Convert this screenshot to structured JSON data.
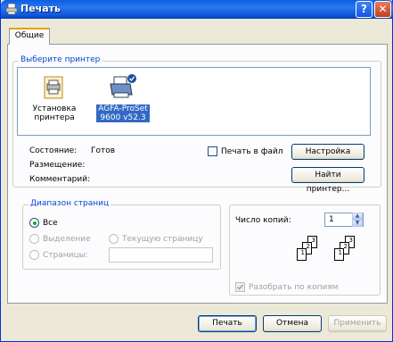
{
  "window": {
    "title": "Печать",
    "help_btn": "?",
    "close_btn": "✕"
  },
  "tabs": [
    {
      "label": "Общие",
      "active": true
    }
  ],
  "printer_group": {
    "title": "Выберите принтер",
    "printers": [
      {
        "line1": "Установка",
        "line2": "принтера",
        "selected": false,
        "icon": "add-printer-icon"
      },
      {
        "line1": "AGFA-ProSet",
        "line2": "9600 v52.3",
        "selected": true,
        "icon": "printer-icon"
      }
    ],
    "status_label": "Состояние:",
    "status_value": "Готов",
    "location_label": "Размещение:",
    "comment_label": "Комментарий:",
    "print_to_file_label": "Печать в файл",
    "print_to_file_checked": false,
    "settings_button": "Настройка",
    "find_printer_button": "Найти принтер..."
  },
  "range_group": {
    "title": "Диапазон страниц",
    "all_label": "Все",
    "selection_label": "Выделение",
    "current_page_label": "Текущую страницу",
    "pages_label": "Страницы:",
    "pages_value": "",
    "selected": "all"
  },
  "copies": {
    "label": "Число копий:",
    "value": "1",
    "collate_label": "Разобрать по копиям",
    "collate_checked": true
  },
  "buttons": {
    "print": "Печать",
    "cancel": "Отмена",
    "apply": "Применить"
  },
  "colors": {
    "accent": "#0046d5",
    "selection": "#316ac5",
    "titlebar": "#0a5fe2"
  }
}
